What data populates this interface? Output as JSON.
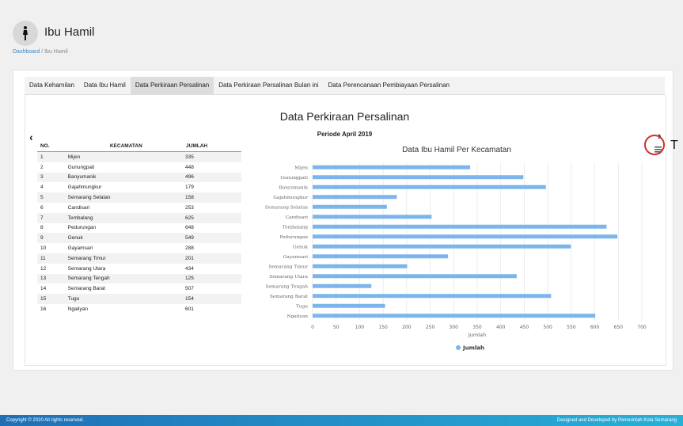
{
  "page": {
    "title": "Ibu Hamil"
  },
  "breadcrumb": {
    "home": "Dashboard",
    "separator": "/",
    "current": "Ibu Hamil"
  },
  "tabs": [
    {
      "label": "Data Kehamilan",
      "active": false
    },
    {
      "label": "Data Ibu Hamil",
      "active": false
    },
    {
      "label": "Data Perkiraan Persalinan",
      "active": true
    },
    {
      "label": "Data Perkiraan Persalinan Bulan ini",
      "active": false
    },
    {
      "label": "Data Perencanaan Pembiayaan Persalinan",
      "active": false
    }
  ],
  "slide": {
    "title": "Data Perkiraan Persalinan",
    "period": "Periode April 2019",
    "prev_icon": "chevron-left-icon",
    "next_icon": "chevron-right-icon",
    "cut_text": "T"
  },
  "table": {
    "headers": [
      "NO.",
      "KECAMATAN",
      "JUMLAH"
    ],
    "rows": [
      [
        "1",
        "Mijen",
        "335"
      ],
      [
        "2",
        "Gunungpati",
        "448"
      ],
      [
        "3",
        "Banyumanik",
        "496"
      ],
      [
        "4",
        "Gajahmungkur",
        "179"
      ],
      [
        "5",
        "Semarang Selatan",
        "158"
      ],
      [
        "6",
        "Candisari",
        "253"
      ],
      [
        "7",
        "Tembalang",
        "625"
      ],
      [
        "8",
        "Pedurungan",
        "648"
      ],
      [
        "9",
        "Genuk",
        "549"
      ],
      [
        "10",
        "Gayamsari",
        "288"
      ],
      [
        "11",
        "Semarang Timur",
        "201"
      ],
      [
        "12",
        "Semarang Utara",
        "434"
      ],
      [
        "13",
        "Semarang Tengah",
        "125"
      ],
      [
        "14",
        "Semarang Barat",
        "507"
      ],
      [
        "15",
        "Tugu",
        "154"
      ],
      [
        "16",
        "Ngaliyan",
        "601"
      ]
    ]
  },
  "chart_data": {
    "type": "bar",
    "orientation": "horizontal",
    "title": "Data Ibu Hamil Per Kecamatan",
    "categories": [
      "Mijen",
      "Gunungpati",
      "Banyumanik",
      "Gajahmungkur",
      "Semarang Selatan",
      "Candisari",
      "Tembalang",
      "Pedurungan",
      "Genuk",
      "Gayamsari",
      "Semarang Timur",
      "Semarang Utara",
      "Semarang Tengah",
      "Semarang Barat",
      "Tugu",
      "Ngaliyan"
    ],
    "series": [
      {
        "name": "Jumlah",
        "values": [
          335,
          448,
          496,
          179,
          158,
          253,
          625,
          648,
          549,
          288,
          201,
          434,
          125,
          507,
          154,
          601
        ]
      }
    ],
    "xlabel": "Jumlah",
    "ylabel": "",
    "xlim": [
      0,
      700
    ],
    "xticks": [
      "0",
      "50",
      "100",
      "150",
      "200",
      "250",
      "300",
      "350",
      "400",
      "450",
      "500",
      "550",
      "600",
      "650",
      "700"
    ],
    "legend": "bottom",
    "color": "#7cb5ec",
    "grid": true
  },
  "menu": {
    "icon": "hamburger-menu-icon",
    "highlight_color": "#d32f2f"
  },
  "footer": {
    "left": "Copyright © 2020 All rights reserved.",
    "right": "Designed and Developed by Pemerintah Kota Semarang"
  }
}
